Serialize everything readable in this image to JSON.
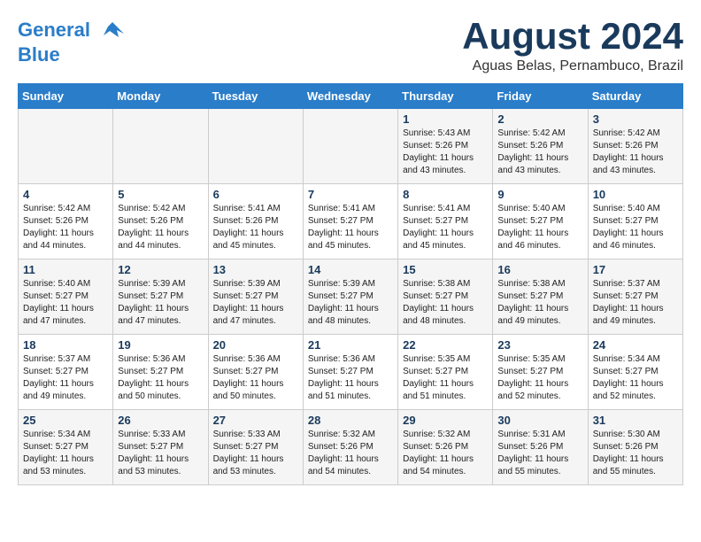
{
  "header": {
    "logo_line1": "General",
    "logo_line2": "Blue",
    "month_title": "August 2024",
    "location": "Aguas Belas, Pernambuco, Brazil"
  },
  "weekdays": [
    "Sunday",
    "Monday",
    "Tuesday",
    "Wednesday",
    "Thursday",
    "Friday",
    "Saturday"
  ],
  "weeks": [
    [
      {
        "day": "",
        "info": ""
      },
      {
        "day": "",
        "info": ""
      },
      {
        "day": "",
        "info": ""
      },
      {
        "day": "",
        "info": ""
      },
      {
        "day": "1",
        "info": "Sunrise: 5:43 AM\nSunset: 5:26 PM\nDaylight: 11 hours\nand 43 minutes."
      },
      {
        "day": "2",
        "info": "Sunrise: 5:42 AM\nSunset: 5:26 PM\nDaylight: 11 hours\nand 43 minutes."
      },
      {
        "day": "3",
        "info": "Sunrise: 5:42 AM\nSunset: 5:26 PM\nDaylight: 11 hours\nand 43 minutes."
      }
    ],
    [
      {
        "day": "4",
        "info": "Sunrise: 5:42 AM\nSunset: 5:26 PM\nDaylight: 11 hours\nand 44 minutes."
      },
      {
        "day": "5",
        "info": "Sunrise: 5:42 AM\nSunset: 5:26 PM\nDaylight: 11 hours\nand 44 minutes."
      },
      {
        "day": "6",
        "info": "Sunrise: 5:41 AM\nSunset: 5:26 PM\nDaylight: 11 hours\nand 45 minutes."
      },
      {
        "day": "7",
        "info": "Sunrise: 5:41 AM\nSunset: 5:27 PM\nDaylight: 11 hours\nand 45 minutes."
      },
      {
        "day": "8",
        "info": "Sunrise: 5:41 AM\nSunset: 5:27 PM\nDaylight: 11 hours\nand 45 minutes."
      },
      {
        "day": "9",
        "info": "Sunrise: 5:40 AM\nSunset: 5:27 PM\nDaylight: 11 hours\nand 46 minutes."
      },
      {
        "day": "10",
        "info": "Sunrise: 5:40 AM\nSunset: 5:27 PM\nDaylight: 11 hours\nand 46 minutes."
      }
    ],
    [
      {
        "day": "11",
        "info": "Sunrise: 5:40 AM\nSunset: 5:27 PM\nDaylight: 11 hours\nand 47 minutes."
      },
      {
        "day": "12",
        "info": "Sunrise: 5:39 AM\nSunset: 5:27 PM\nDaylight: 11 hours\nand 47 minutes."
      },
      {
        "day": "13",
        "info": "Sunrise: 5:39 AM\nSunset: 5:27 PM\nDaylight: 11 hours\nand 47 minutes."
      },
      {
        "day": "14",
        "info": "Sunrise: 5:39 AM\nSunset: 5:27 PM\nDaylight: 11 hours\nand 48 minutes."
      },
      {
        "day": "15",
        "info": "Sunrise: 5:38 AM\nSunset: 5:27 PM\nDaylight: 11 hours\nand 48 minutes."
      },
      {
        "day": "16",
        "info": "Sunrise: 5:38 AM\nSunset: 5:27 PM\nDaylight: 11 hours\nand 49 minutes."
      },
      {
        "day": "17",
        "info": "Sunrise: 5:37 AM\nSunset: 5:27 PM\nDaylight: 11 hours\nand 49 minutes."
      }
    ],
    [
      {
        "day": "18",
        "info": "Sunrise: 5:37 AM\nSunset: 5:27 PM\nDaylight: 11 hours\nand 49 minutes."
      },
      {
        "day": "19",
        "info": "Sunrise: 5:36 AM\nSunset: 5:27 PM\nDaylight: 11 hours\nand 50 minutes."
      },
      {
        "day": "20",
        "info": "Sunrise: 5:36 AM\nSunset: 5:27 PM\nDaylight: 11 hours\nand 50 minutes."
      },
      {
        "day": "21",
        "info": "Sunrise: 5:36 AM\nSunset: 5:27 PM\nDaylight: 11 hours\nand 51 minutes."
      },
      {
        "day": "22",
        "info": "Sunrise: 5:35 AM\nSunset: 5:27 PM\nDaylight: 11 hours\nand 51 minutes."
      },
      {
        "day": "23",
        "info": "Sunrise: 5:35 AM\nSunset: 5:27 PM\nDaylight: 11 hours\nand 52 minutes."
      },
      {
        "day": "24",
        "info": "Sunrise: 5:34 AM\nSunset: 5:27 PM\nDaylight: 11 hours\nand 52 minutes."
      }
    ],
    [
      {
        "day": "25",
        "info": "Sunrise: 5:34 AM\nSunset: 5:27 PM\nDaylight: 11 hours\nand 53 minutes."
      },
      {
        "day": "26",
        "info": "Sunrise: 5:33 AM\nSunset: 5:27 PM\nDaylight: 11 hours\nand 53 minutes."
      },
      {
        "day": "27",
        "info": "Sunrise: 5:33 AM\nSunset: 5:27 PM\nDaylight: 11 hours\nand 53 minutes."
      },
      {
        "day": "28",
        "info": "Sunrise: 5:32 AM\nSunset: 5:26 PM\nDaylight: 11 hours\nand 54 minutes."
      },
      {
        "day": "29",
        "info": "Sunrise: 5:32 AM\nSunset: 5:26 PM\nDaylight: 11 hours\nand 54 minutes."
      },
      {
        "day": "30",
        "info": "Sunrise: 5:31 AM\nSunset: 5:26 PM\nDaylight: 11 hours\nand 55 minutes."
      },
      {
        "day": "31",
        "info": "Sunrise: 5:30 AM\nSunset: 5:26 PM\nDaylight: 11 hours\nand 55 minutes."
      }
    ]
  ]
}
